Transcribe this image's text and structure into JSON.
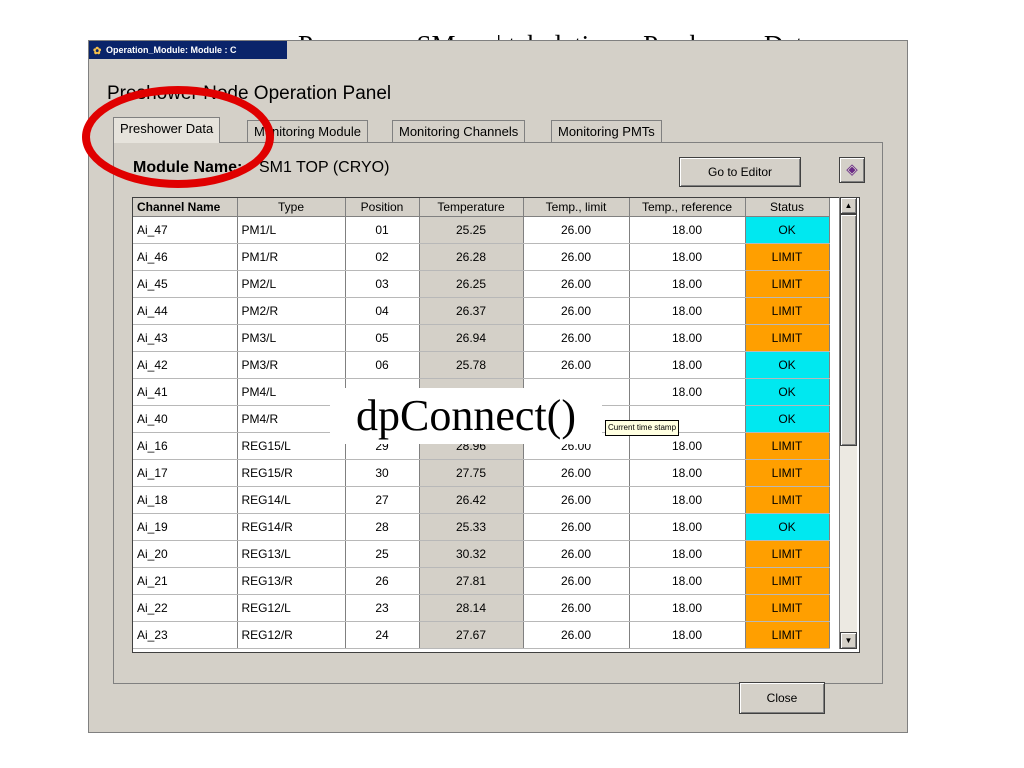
{
  "slide": {
    "title": "Panneau « SMx » | tabulation « Preshower Data »"
  },
  "window": {
    "title": "Operation_Module: Module : C",
    "heading": "Preshower Node Operation Panel"
  },
  "tabs": [
    {
      "label": "Preshower Data",
      "active": true
    },
    {
      "label": "Monitoring Module",
      "active": false
    },
    {
      "label": "Monitoring Channels",
      "active": false
    },
    {
      "label": "Monitoring PMTs",
      "active": false
    }
  ],
  "module": {
    "label": "Module Name:",
    "value": "SM1  TOP (CRYO)"
  },
  "buttons": {
    "go_to_editor": "Go to Editor",
    "close": "Close"
  },
  "icons": {
    "app": "gear-icon",
    "book": "book-icon",
    "scroll_up": "triangle-up-icon",
    "scroll_down": "triangle-down-icon"
  },
  "colors": {
    "status_ok": "#00e8f0",
    "status_limit": "#ff9f00",
    "highlight": "#e00000",
    "titlebar": "#0a246a"
  },
  "table": {
    "columns": [
      "Channel Name",
      "Type",
      "Position",
      "Temperature",
      "Temp., limit",
      "Temp., reference",
      "Status"
    ],
    "rows": [
      [
        "Ai_47",
        "PM1/L",
        "01",
        "25.25",
        "26.00",
        "18.00",
        "OK"
      ],
      [
        "Ai_46",
        "PM1/R",
        "02",
        "26.28",
        "26.00",
        "18.00",
        "LIMIT"
      ],
      [
        "Ai_45",
        "PM2/L",
        "03",
        "26.25",
        "26.00",
        "18.00",
        "LIMIT"
      ],
      [
        "Ai_44",
        "PM2/R",
        "04",
        "26.37",
        "26.00",
        "18.00",
        "LIMIT"
      ],
      [
        "Ai_43",
        "PM3/L",
        "05",
        "26.94",
        "26.00",
        "18.00",
        "LIMIT"
      ],
      [
        "Ai_42",
        "PM3/R",
        "06",
        "25.78",
        "26.00",
        "18.00",
        "OK"
      ],
      [
        "Ai_41",
        "PM4/L",
        "",
        "",
        "",
        "18.00",
        "OK"
      ],
      [
        "Ai_40",
        "PM4/R",
        "",
        "",
        "",
        "",
        "OK"
      ],
      [
        "Ai_16",
        "REG15/L",
        "29",
        "28.96",
        "26.00",
        "18.00",
        "LIMIT"
      ],
      [
        "Ai_17",
        "REG15/R",
        "30",
        "27.75",
        "26.00",
        "18.00",
        "LIMIT"
      ],
      [
        "Ai_18",
        "REG14/L",
        "27",
        "26.42",
        "26.00",
        "18.00",
        "LIMIT"
      ],
      [
        "Ai_19",
        "REG14/R",
        "28",
        "25.33",
        "26.00",
        "18.00",
        "OK"
      ],
      [
        "Ai_20",
        "REG13/L",
        "25",
        "30.32",
        "26.00",
        "18.00",
        "LIMIT"
      ],
      [
        "Ai_21",
        "REG13/R",
        "26",
        "27.81",
        "26.00",
        "18.00",
        "LIMIT"
      ],
      [
        "Ai_22",
        "REG12/L",
        "23",
        "28.14",
        "26.00",
        "18.00",
        "LIMIT"
      ],
      [
        "Ai_23",
        "REG12/R",
        "24",
        "27.67",
        "26.00",
        "18.00",
        "LIMIT"
      ]
    ]
  },
  "overlay": {
    "text": "dpConnect()"
  },
  "tooltip": {
    "text": "Current time stamp"
  }
}
